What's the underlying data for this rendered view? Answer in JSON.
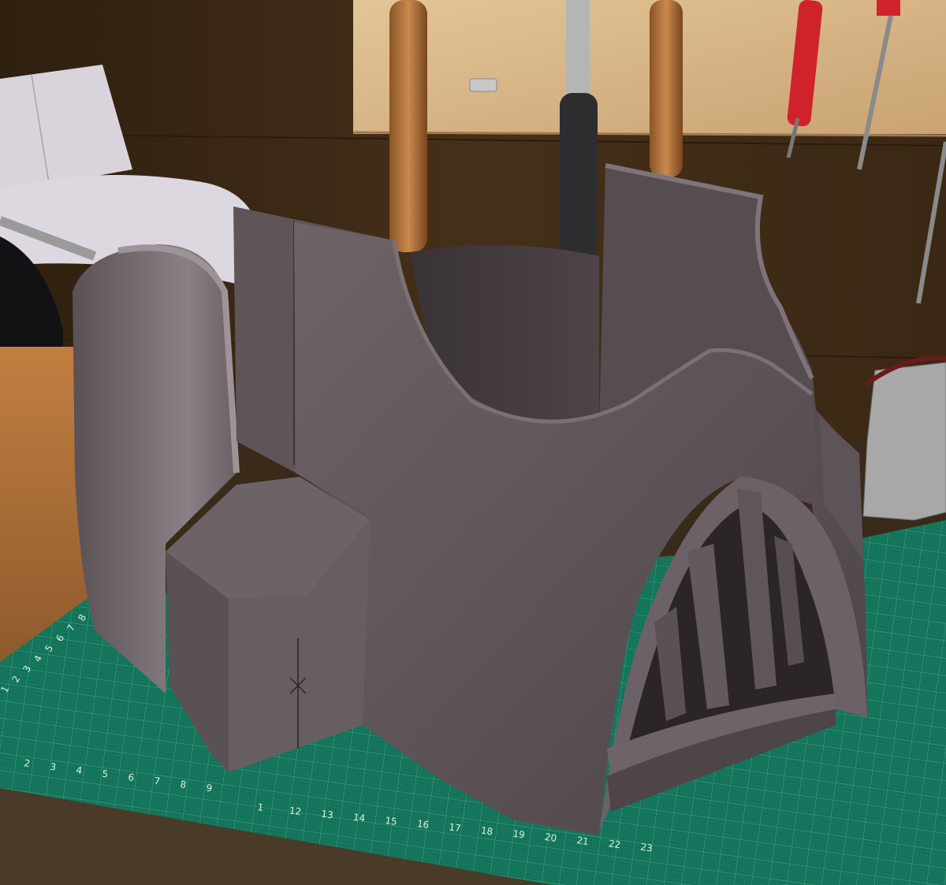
{
  "photo": {
    "colors": {
      "wall": "#3d2a14",
      "board": "#d9b88a",
      "table": "#b0723a",
      "mat": "#13735a",
      "mat_grid": "#4fa88d",
      "foam": "#5e5458",
      "foam_light": "#7b7075",
      "foam_dark": "#3e3639",
      "metal": "#9a9a9a"
    },
    "mat_ruler_bottom": [
      "1",
      "12",
      "13",
      "14",
      "15",
      "16",
      "17",
      "18",
      "19",
      "20",
      "21",
      "22",
      "23"
    ],
    "mat_ruler_left_bottom": [
      "2",
      "3",
      "4",
      "5",
      "6",
      "7",
      "8",
      "9"
    ],
    "mat_ruler_left_side": [
      "1",
      "2",
      "3",
      "4",
      "5",
      "6",
      "7",
      "8"
    ]
  }
}
